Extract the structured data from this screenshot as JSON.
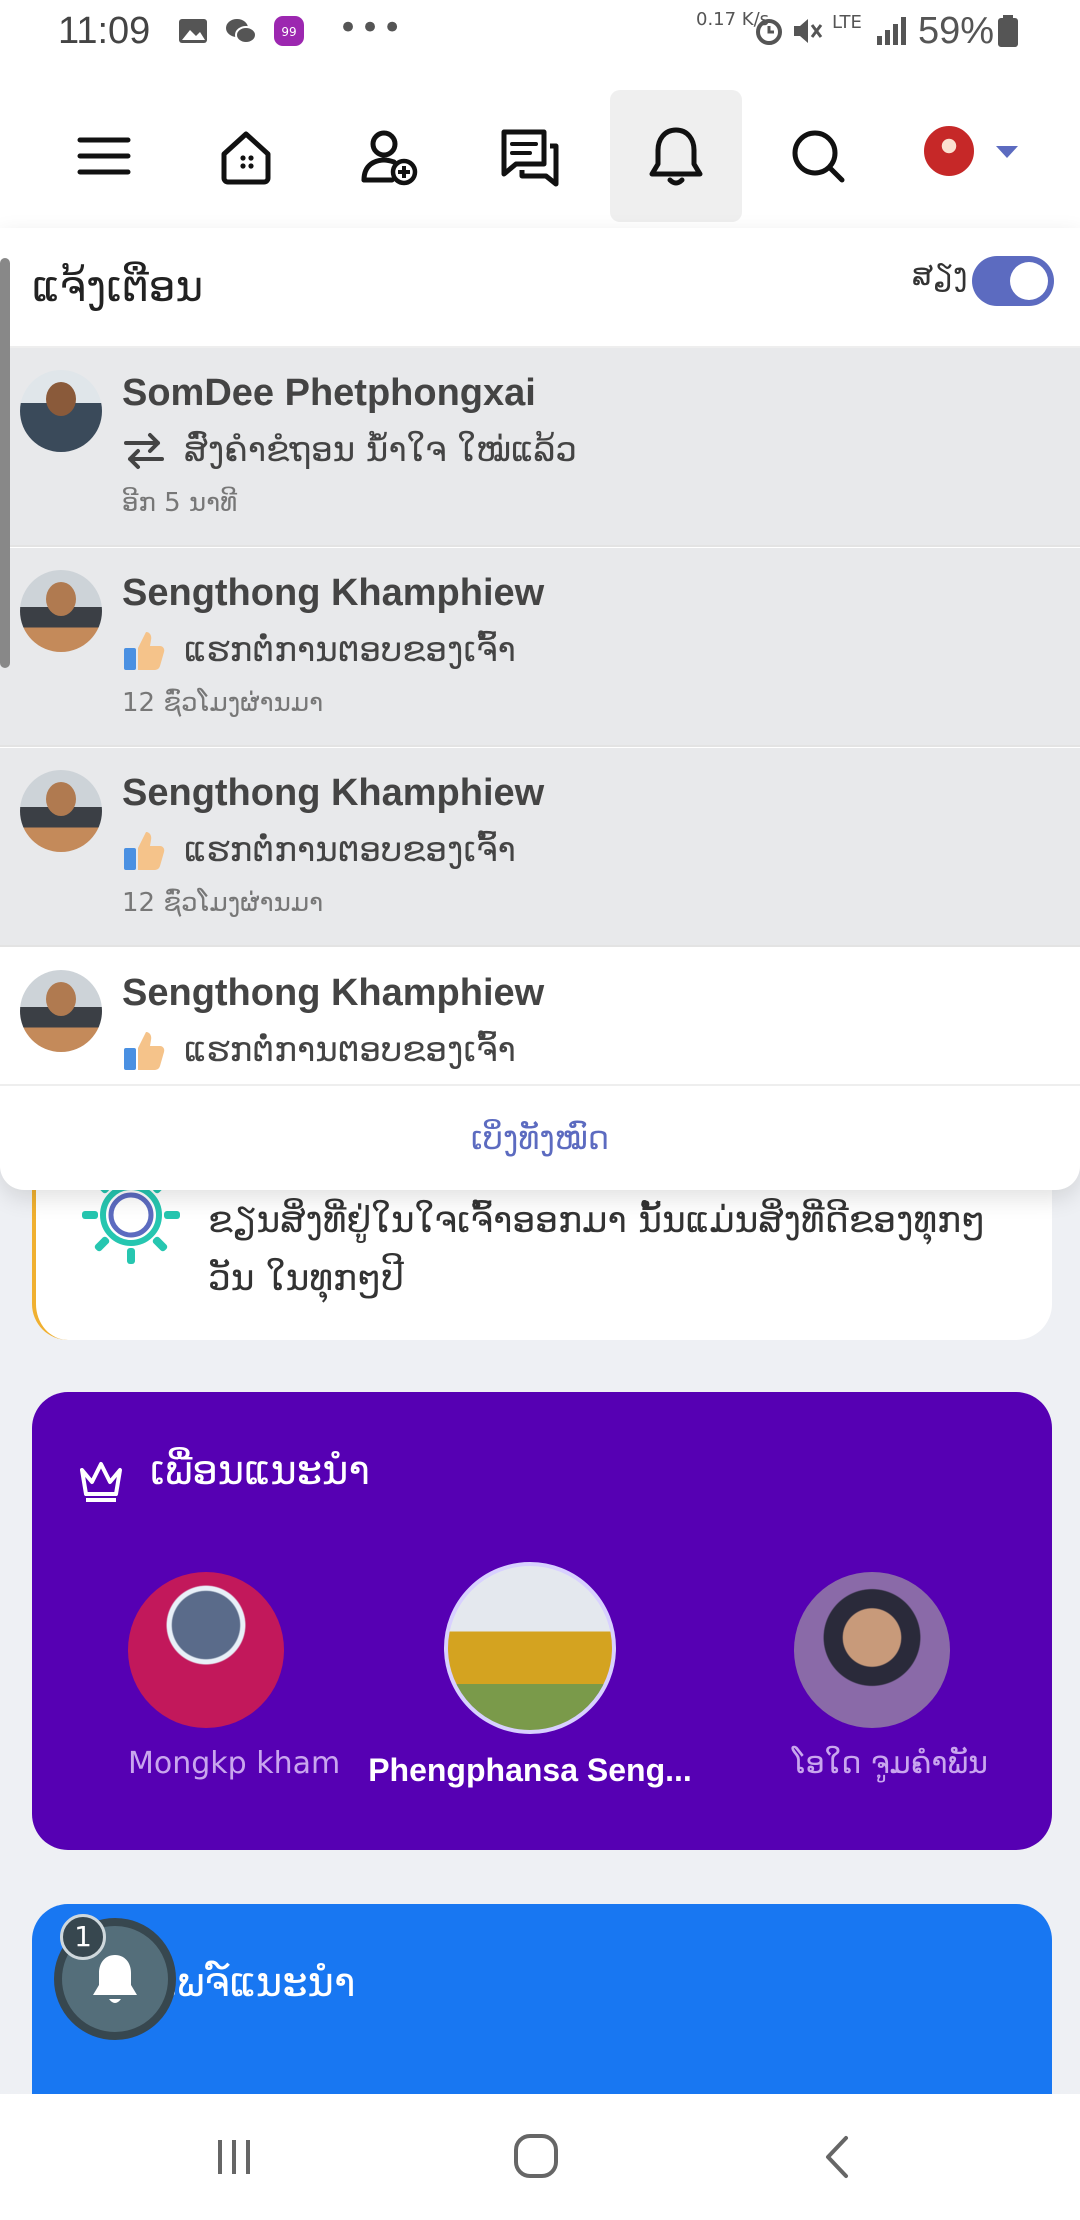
{
  "status_bar": {
    "time": "11:09",
    "network_speed": "0.17 K/s",
    "network_type": "LTE",
    "battery": "59%"
  },
  "nav": {
    "icons": [
      "menu-icon",
      "home-icon",
      "add-friend-icon",
      "messages-icon",
      "bell-icon",
      "search-icon"
    ],
    "active": "bell-icon",
    "accent": "#5c6bc0"
  },
  "notifications": {
    "title": "ແຈ້ງເຕືອນ",
    "sound_label": "ສຽງ",
    "sound_on": true,
    "see_all": "ເບິ່ງທັງໝົດ",
    "items": [
      {
        "name": "SomDee Phetphongxai",
        "message": "ສົ່ງຄຳຂໍຖອນ ນ້ຳໃຈ ໃໝ່ແລ້ວ",
        "time": "ອີກ 5 ນາທີ",
        "icon": "transfer-icon",
        "unread": true
      },
      {
        "name": "Sengthong Khamphiew",
        "message": "ແຮກຕໍ່ການຕອບຂອງເຈົ້າ",
        "time": "12 ຊົ່ວໂມງຜ່ານມາ",
        "icon": "thumbs-up-icon",
        "unread": true
      },
      {
        "name": "Sengthong Khamphiew",
        "message": "ແຮກຕໍ່ການຕອບຂອງເຈົ້າ",
        "time": "12 ຊົ່ວໂມງຜ່ານມາ",
        "icon": "thumbs-up-icon",
        "unread": true
      },
      {
        "name": "Sengthong Khamphiew",
        "message": "ແຮກຕໍ່ການຕອບຂອງເຈົ້າ",
        "time": "",
        "icon": "thumbs-up-icon",
        "unread": false
      }
    ]
  },
  "background": {
    "card_text": "ຂຽນສິ່ງທີ່ຢູ່ໃນໃຈເຈົ້າອອກມາ ນັ້ນແມ່ນສິ່ງທີ່ດີຂອງທຸກໆວັນ ໃນທຸກໆປີ",
    "suggest_title": "ເພື່ອນແນະນຳ",
    "suggest_colors": {
      "bg": "#5600b3"
    },
    "friends": [
      {
        "name": "Mongkp kham"
      },
      {
        "name": "Phengphansa Seng..."
      },
      {
        "name": "ໂອໃດ ຈູມຄຳພັນ"
      }
    ],
    "pages_title": "ເພຈ໌ແນະນຳ",
    "float_badge": "1"
  }
}
